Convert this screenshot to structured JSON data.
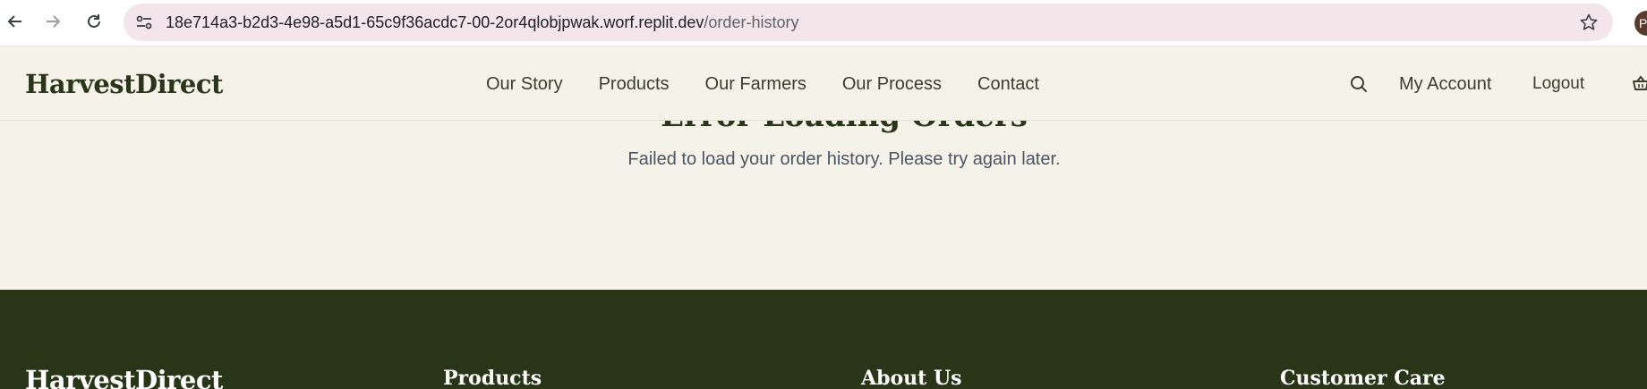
{
  "browser": {
    "url_host": "18e714a3-b2d3-4e98-a5d1-65c9f36acdc7-00-2or4qlobjpwak.worf.replit.dev",
    "url_path": "/order-history",
    "profile_initial": "P"
  },
  "header": {
    "logo": "HarvestDirect",
    "nav": [
      "Our Story",
      "Products",
      "Our Farmers",
      "Our Process",
      "Contact"
    ],
    "account": "My Account",
    "logout": "Logout"
  },
  "main": {
    "error_title": "Error Loading Orders",
    "error_message": "Failed to load your order history. Please try again later."
  },
  "footer": {
    "logo": "HarvestDirect",
    "headings": [
      "Products",
      "About Us",
      "Customer Care"
    ]
  },
  "colors": {
    "background": "#f5f2ea",
    "brand_dark": "#2a361a",
    "footer": "#283517"
  }
}
